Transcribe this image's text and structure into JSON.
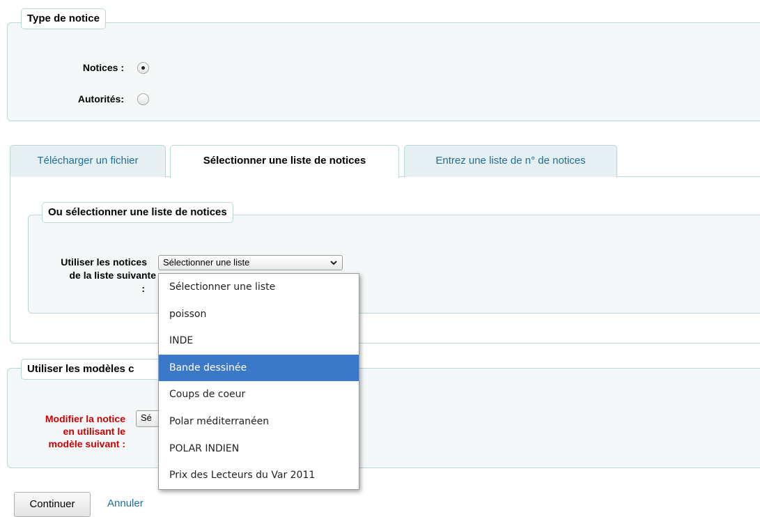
{
  "record_type": {
    "legend": "Type de notice",
    "options": [
      {
        "label": "Notices :",
        "checked": true
      },
      {
        "label": "Autorités:",
        "checked": false
      }
    ]
  },
  "tabs": [
    {
      "label": "Télécharger un fichier",
      "active": false
    },
    {
      "label": "Sélectionner une liste de notices",
      "active": true
    },
    {
      "label": "Entrez une liste de n° de notices",
      "active": false
    }
  ],
  "list_section": {
    "legend": "Ou sélectionner une liste de notices",
    "label_line1": "Utiliser les notices",
    "label_line2": "de la liste suivante",
    "label_line3": ":",
    "select_value": "Sélectionner une liste",
    "options": [
      "Sélectionner une liste",
      "poisson",
      "INDE",
      "Bande dessinée",
      "Coups de coeur",
      "Polar méditerranéen",
      "POLAR INDIEN",
      "Prix des Lecteurs du Var 2011"
    ],
    "highlighted_option": "Bande dessinée"
  },
  "template_section": {
    "legend": "Utiliser les modèles c",
    "label_line1": "Modifier la notice",
    "label_line2": "en utilisant le",
    "label_line3": "modèle suivant :",
    "select_value": "Sé",
    "label_color": "#cc0000"
  },
  "actions": {
    "continue_label": "Continuer",
    "cancel_label": "Annuler"
  }
}
